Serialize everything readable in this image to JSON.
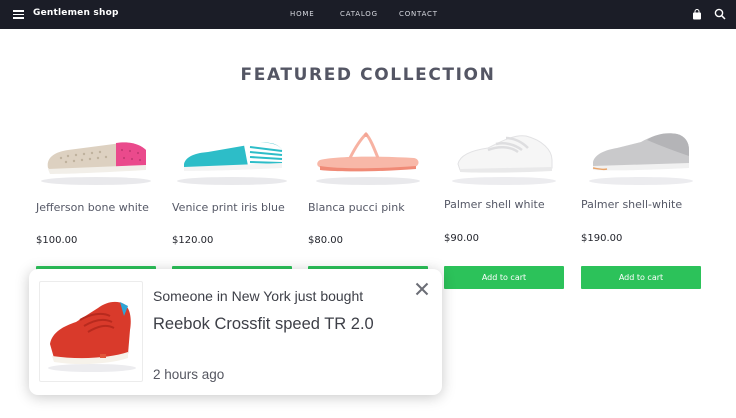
{
  "header": {
    "brand": "Gentlemen shop",
    "nav": [
      {
        "label": "HOME"
      },
      {
        "label": "CATALOG"
      },
      {
        "label": "CONTACT"
      }
    ]
  },
  "section": {
    "title": "FEATURED COLLECTION"
  },
  "products": [
    {
      "name": "Jefferson bone white",
      "price": "$100.00",
      "cart_label": ""
    },
    {
      "name": "Venice print iris blue",
      "price": "$120.00",
      "cart_label": ""
    },
    {
      "name": "Blanca pucci pink",
      "price": "$80.00",
      "cart_label": ""
    },
    {
      "name": "Palmer shell white",
      "price": "$90.00",
      "cart_label": "Add to cart"
    },
    {
      "name": "Palmer shell-white",
      "price": "$190.00",
      "cart_label": "Add to cart"
    }
  ],
  "notification": {
    "message": "Someone in New York just bought",
    "product": "Reebok Crossfit speed TR 2.0",
    "time": "2 hours ago"
  },
  "colors": {
    "topbar": "#1b1d27",
    "accent_green": "#2cc25a",
    "heading": "#545664"
  },
  "icons": [
    "menu-icon",
    "shopping-bag-icon",
    "search-icon",
    "close-icon"
  ]
}
